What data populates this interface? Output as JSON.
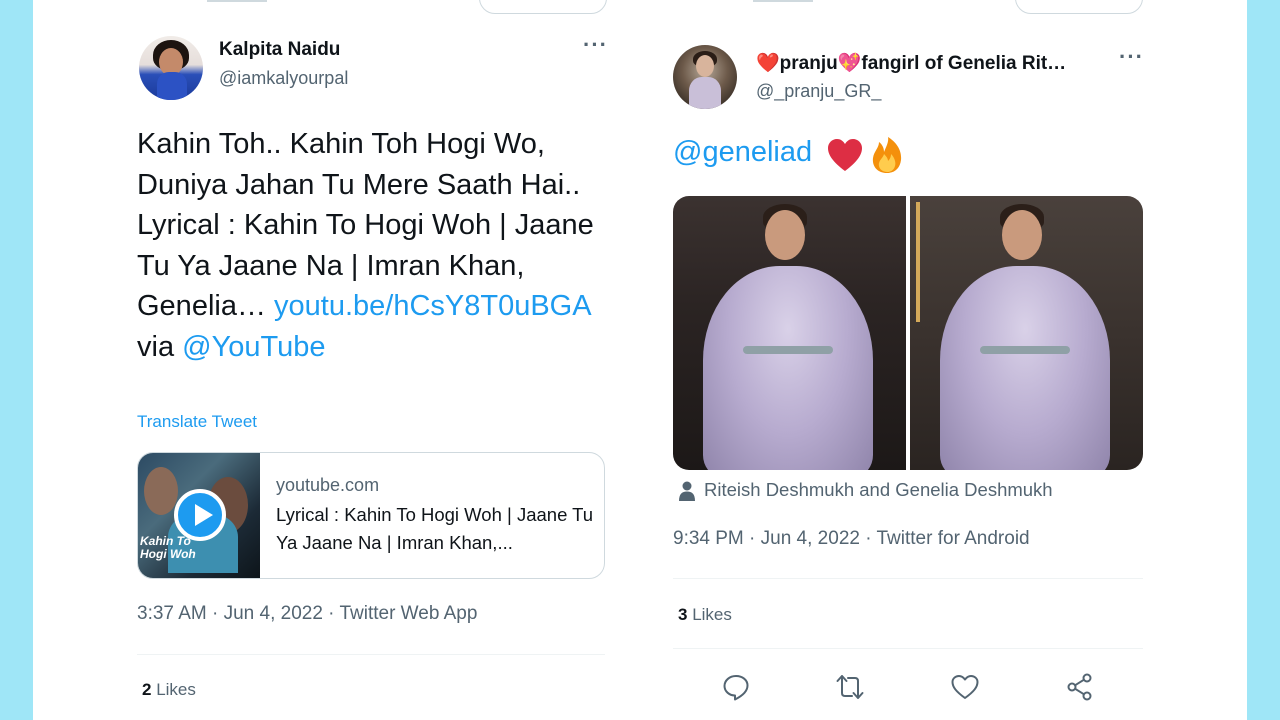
{
  "tweet1": {
    "author_name": "Kalpita Naidu",
    "author_handle": "@iamkalyourpal",
    "more_label": "···",
    "text_main": "Kahin Toh.. Kahin Toh Hogi Wo, Duniya Jahan Tu Mere Saath Hai.. Lyrical : Kahin To Hogi Woh | Jaane Tu Ya Jaane Na | Imran Khan, Genelia… ",
    "text_link": "youtu.be/hCsY8T0uBGA",
    "text_via": " via ",
    "text_mention": "@YouTube",
    "translate_label": "Translate Tweet",
    "card": {
      "thumb_caption": "Kahin To Hogi Woh",
      "domain": "youtube.com",
      "title": "Lyrical : Kahin To Hogi Woh | Jaane Tu Ya Jaane Na | Imran Khan,..."
    },
    "timestamp": "3:37 AM · Jun 4, 2022 · Twitter Web App",
    "likes_count": "2",
    "likes_label": " Likes"
  },
  "tweet2": {
    "author_name": "❤️pranju💖fangirl of Genelia Rit…",
    "author_handle": "@_pranju_GR_",
    "more_label": "···",
    "mention": "@geneliad",
    "tagged": "Riteish Deshmukh and Genelia Deshmukh",
    "timestamp": "9:34 PM · Jun 4, 2022 · Twitter for Android",
    "likes_count": "3",
    "likes_label": " Likes"
  },
  "colors": {
    "side_band": "#9fe6f7",
    "link": "#1d9bf0",
    "muted": "#536471",
    "text": "#0f1419"
  },
  "icons": [
    "more-icon",
    "play-icon",
    "heart-emoji",
    "fire-emoji",
    "person-icon",
    "reply-icon",
    "retweet-icon",
    "like-icon",
    "share-icon"
  ]
}
